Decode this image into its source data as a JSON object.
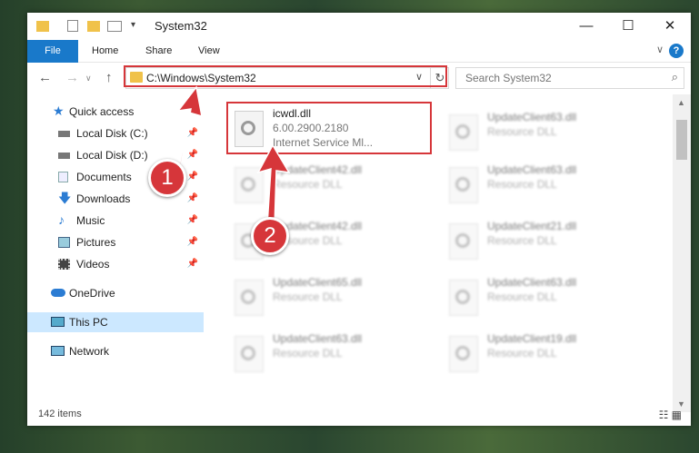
{
  "window": {
    "title": "System32",
    "minimize": "—",
    "maximize": "☐",
    "close": "✕"
  },
  "ribbon": {
    "tabs": [
      "File",
      "Home",
      "Share",
      "View"
    ],
    "help": "?",
    "collapse": "∨"
  },
  "address": {
    "path": "C:\\Windows\\System32",
    "search_placeholder": "Search System32"
  },
  "nav": {
    "items": [
      {
        "label": "Quick access",
        "icon": "star-icon"
      },
      {
        "label": "Local Disk (C:)",
        "icon": "drive-icon",
        "pinned": true
      },
      {
        "label": "Local Disk (D:)",
        "icon": "drive-icon",
        "pinned": true
      },
      {
        "label": "Documents",
        "icon": "documents-icon",
        "pinned": true
      },
      {
        "label": "Downloads",
        "icon": "downloads-icon",
        "pinned": true
      },
      {
        "label": "Music",
        "icon": "music-icon",
        "pinned": true
      },
      {
        "label": "Pictures",
        "icon": "pictures-icon",
        "pinned": true
      },
      {
        "label": "Videos",
        "icon": "videos-icon",
        "pinned": true
      },
      {
        "label": "OneDrive",
        "icon": "cloud-icon"
      },
      {
        "label": "This PC",
        "icon": "computer-icon",
        "selected": true
      },
      {
        "label": "Network",
        "icon": "network-icon"
      }
    ]
  },
  "files": {
    "highlighted": {
      "name": "icwdl.dll",
      "version": "6.00.2900.2180",
      "description": "Internet Service Ml..."
    },
    "blurred_left": [
      {
        "name": "UpdateClient42.dll",
        "type": "Resource DLL"
      },
      {
        "name": "UpdateClient42.dll",
        "type": "Resource DLL"
      },
      {
        "name": "UpdateClient65.dll",
        "type": "Resource DLL"
      },
      {
        "name": "UpdateClient63.dll",
        "type": "Resource DLL"
      }
    ],
    "blurred_right": [
      {
        "name": "UpdateClient63.dll",
        "type": "Resource DLL"
      },
      {
        "name": "UpdateClient63.dll",
        "type": "Resource DLL"
      },
      {
        "name": "UpdateClient21.dll",
        "type": "Resource DLL"
      },
      {
        "name": "UpdateClient63.dll",
        "type": "Resource DLL"
      },
      {
        "name": "UpdateClient19.dll",
        "type": "Resource DLL"
      }
    ]
  },
  "status": {
    "item_count": "142 items"
  },
  "callouts": {
    "one": "1",
    "two": "2"
  },
  "colors": {
    "accent": "#1979ca",
    "highlight": "#d6363a",
    "selected": "#cce8ff"
  }
}
